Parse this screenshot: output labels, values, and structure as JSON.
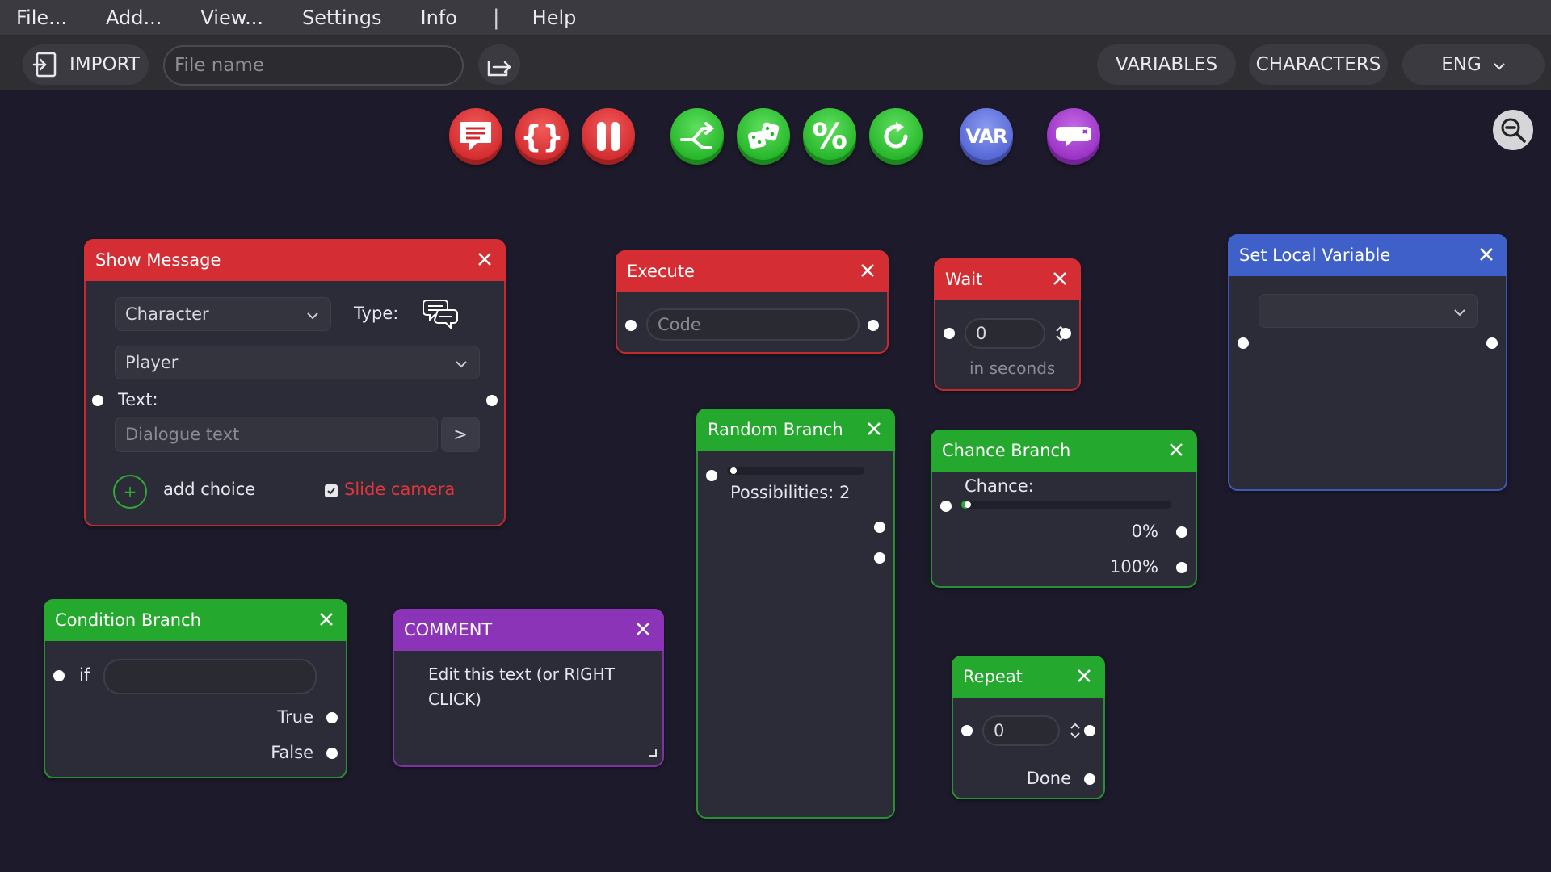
{
  "menu": {
    "file": "File...",
    "add": "Add...",
    "view": "View...",
    "settings": "Settings",
    "info": "Info",
    "separator": "|",
    "help": "Help"
  },
  "toolbar": {
    "import_label": "IMPORT",
    "file_placeholder": "File name",
    "variables_label": "VARIABLES",
    "characters_label": "CHARACTERS",
    "language": "ENG"
  },
  "palette": {
    "var_label": "VAR",
    "colors": {
      "red": "#d22b2e",
      "green": "#25b529",
      "blue": "#5566d6",
      "purple": "#9830c4"
    }
  },
  "nodes": {
    "show_message": {
      "title": "Show Message",
      "speaker_dropdown": "Character",
      "type_label": "Type:",
      "character_value": "Player",
      "text_label": "Text:",
      "text_placeholder": "Dialogue text",
      "expand_label": ">",
      "add_choice_label": "add choice",
      "slide_camera_label": "Slide camera",
      "slide_camera_checked": true
    },
    "execute": {
      "title": "Execute",
      "code_placeholder": "Code"
    },
    "wait": {
      "title": "Wait",
      "value": "0",
      "unit_label": "in seconds"
    },
    "set_local_variable": {
      "title": "Set Local Variable",
      "dropdown_value": ""
    },
    "random_branch": {
      "title": "Random Branch",
      "possibilities_label": "Possibilities: 2",
      "slider_value": 0.0
    },
    "chance_branch": {
      "title": "Chance Branch",
      "chance_label": "Chance:",
      "slider_value": 0.0,
      "out_a": "0%",
      "out_b": "100%"
    },
    "condition_branch": {
      "title": "Condition Branch",
      "if_label": "if",
      "condition_value": "",
      "true_label": "True",
      "false_label": "False"
    },
    "comment": {
      "title": "COMMENT",
      "text": "Edit this text (or RIGHT CLICK)"
    },
    "repeat": {
      "title": "Repeat",
      "value": "0",
      "done_label": "Done"
    }
  }
}
